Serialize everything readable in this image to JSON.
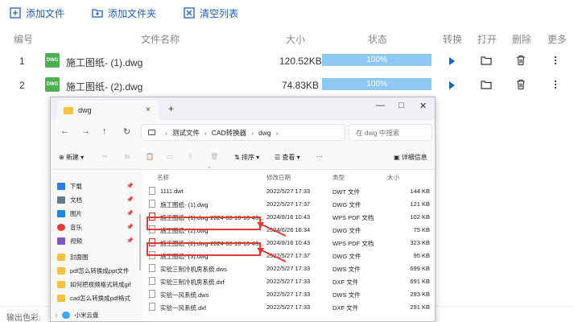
{
  "toolbar": {
    "add_file": "添加文件",
    "add_folder": "添加文件夹",
    "clear_list": "清空列表"
  },
  "table": {
    "headers": {
      "index": "编号",
      "filename": "文件名称",
      "size": "大小",
      "status": "状态",
      "convert": "转换",
      "open": "打开",
      "delete": "删除",
      "more": "更多"
    },
    "rows": [
      {
        "index": "1",
        "badge": "DWG",
        "name": "施工图纸- (1).dwg",
        "size": "120.52KB",
        "progress": "100%"
      },
      {
        "index": "2",
        "badge": "DWG",
        "name": "施工图纸- (2).dwg",
        "size": "74.83KB",
        "progress": "100%"
      }
    ]
  },
  "bottom": {
    "output_color": "输出色彩:"
  },
  "explorer": {
    "tab_title": "dwg",
    "tab_close": "×",
    "tab_add": "+",
    "window_controls": {
      "minimize": "—",
      "maximize": "□",
      "close": "✕"
    },
    "nav": {
      "back": "←",
      "forward": "→",
      "up": "↑",
      "refresh": "↻"
    },
    "address": [
      "测试文件",
      "CAD转换器",
      "dwg"
    ],
    "address_sep": "›",
    "search_placeholder": "在 dwg 中搜索",
    "commands": {
      "new": "新建",
      "sort": "排序",
      "view": "查看",
      "more": "···",
      "details": "详细信息"
    },
    "sidebar": [
      {
        "label": "下载",
        "color": "#2b7de9",
        "pinned": true
      },
      {
        "label": "文档",
        "color": "#607d8b",
        "pinned": true
      },
      {
        "label": "图片",
        "color": "#1e88e5",
        "pinned": true
      },
      {
        "label": "音乐",
        "color": "#e53935",
        "pinned": true
      },
      {
        "label": "视频",
        "color": "#7e57c2",
        "pinned": true
      },
      {
        "label": "封面图",
        "color": "#f5c242",
        "pinned": false
      },
      {
        "label": "pdf怎么转换成ppt文件",
        "color": "#f5c242",
        "pinned": false
      },
      {
        "label": "如何把视频格式转成gif",
        "color": "#f5c242",
        "pinned": false
      },
      {
        "label": "cad怎么转换成pdf格式",
        "color": "#f5c242",
        "pinned": false
      },
      {
        "label": "小米云盘",
        "color": "#42a5f5",
        "pinned": false
      }
    ],
    "pin_glyph": "📌",
    "columns": {
      "name": "名称",
      "date": "修改日期",
      "type": "类型",
      "size": "大小"
    },
    "files": [
      {
        "name": "1111.dwt",
        "date": "2022/5/27 17:33",
        "type": "DWT 文件",
        "size": "144 KB",
        "kind": "file",
        "highlight": false
      },
      {
        "name": "施工图纸- (1).dwg",
        "date": "2022/5/27 17:37",
        "type": "DWG 文件",
        "size": "121 KB",
        "kind": "file",
        "highlight": false
      },
      {
        "name": "施工图纸- (1).dwg-2024-08-16-10-43...",
        "date": "2024/8/16 10:43",
        "type": "WPS PDF 文档",
        "size": "102 KB",
        "kind": "pdf",
        "highlight": true
      },
      {
        "name": "施工图纸- (2).dwg",
        "date": "2024/6/26 16:34",
        "type": "DWG 文件",
        "size": "75 KB",
        "kind": "file",
        "highlight": false
      },
      {
        "name": "施工图纸- (2).dwg-2024-08-16-10-43...",
        "date": "2024/8/16 10:43",
        "type": "WPS PDF 文档",
        "size": "323 KB",
        "kind": "pdf",
        "highlight": true
      },
      {
        "name": "施工图纸- (3).dwg",
        "date": "2022/5/27 17:37",
        "type": "DWG 文件",
        "size": "95 KB",
        "kind": "file",
        "highlight": false
      },
      {
        "name": "实验三制冷机房系统.dws",
        "date": "2022/5/27 17:33",
        "type": "DWS 文件",
        "size": "699 KB",
        "kind": "file",
        "highlight": false
      },
      {
        "name": "实验三制冷机房系统.dxf",
        "date": "2022/5/27 17:33",
        "type": "DXF 文件",
        "size": "691 KB",
        "kind": "file",
        "highlight": false
      },
      {
        "name": "实验一风系统.dws",
        "date": "2022/5/27 17:33",
        "type": "DWS 文件",
        "size": "293 KB",
        "kind": "file",
        "highlight": false
      },
      {
        "name": "实验一风系统.dxf",
        "date": "2022/5/27 17:33",
        "type": "DXF 文件",
        "size": "291 KB",
        "kind": "file",
        "highlight": false
      }
    ]
  },
  "colors": {
    "accent": "#1f5fb8",
    "progress": "#8fc9f3",
    "play": "#1565c0",
    "highlight": "#e53935",
    "badge": "#4caf50"
  }
}
